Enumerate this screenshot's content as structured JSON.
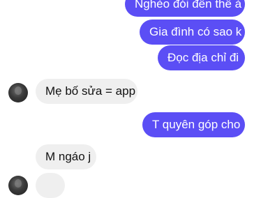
{
  "messages": [
    {
      "side": "out",
      "text": "Nghèo đói đến thế à"
    },
    {
      "side": "out",
      "text": "Gia đình có sao k"
    },
    {
      "side": "out",
      "text": "Đọc địa chỉ đi"
    },
    {
      "side": "in",
      "text": "Mẹ bố sửa = app"
    },
    {
      "side": "out",
      "text": "T quyên góp cho"
    },
    {
      "side": "in",
      "text": "M ngáo j"
    }
  ],
  "colors": {
    "outgoing_bubble": "#5b4ef5",
    "incoming_bubble": "#efefef"
  }
}
